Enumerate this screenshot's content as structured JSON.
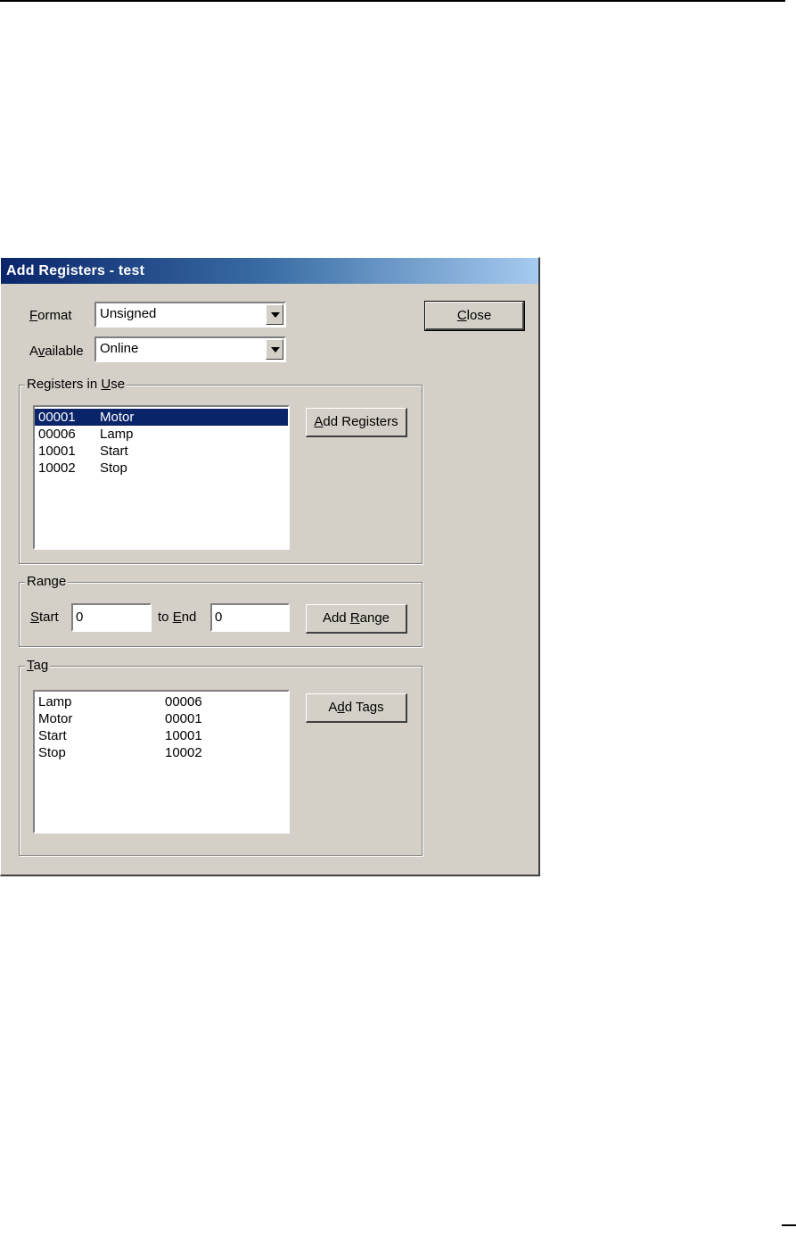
{
  "window": {
    "title": "Add Registers - test"
  },
  "format": {
    "label_key": "F",
    "label_rest": "ormat",
    "value": "Unsigned"
  },
  "available": {
    "label_pre": "A",
    "label_key": "v",
    "label_rest": "ailable",
    "value": "Online"
  },
  "close_button": {
    "key": "C",
    "rest": "lose"
  },
  "registers_group": {
    "title_pre": "Registers in ",
    "title_key": "U",
    "title_rest": "se",
    "rows": [
      {
        "address": "00001",
        "name": "Motor"
      },
      {
        "address": "00006",
        "name": "Lamp"
      },
      {
        "address": "10001",
        "name": "Start"
      },
      {
        "address": "10002",
        "name": "Stop"
      }
    ],
    "selected_index": 0,
    "add_button": {
      "key": "A",
      "rest": "dd Registers"
    }
  },
  "range_group": {
    "title": "Range",
    "start_key": "S",
    "start_rest": "tart",
    "start_value": "0",
    "to_pre": "to ",
    "end_key": "E",
    "end_rest": "nd",
    "end_value": "0",
    "add_button": {
      "pre": "Add ",
      "key": "R",
      "rest": "ange"
    }
  },
  "tag_group": {
    "title_key": "T",
    "title_rest": "ag",
    "rows": [
      {
        "name": "Lamp",
        "address": "00006"
      },
      {
        "name": "Motor",
        "address": "00001"
      },
      {
        "name": "Start",
        "address": "10001"
      },
      {
        "name": "Stop",
        "address": "10002"
      }
    ],
    "add_button": {
      "pre": "A",
      "key": "d",
      "rest": "d Tags"
    }
  }
}
